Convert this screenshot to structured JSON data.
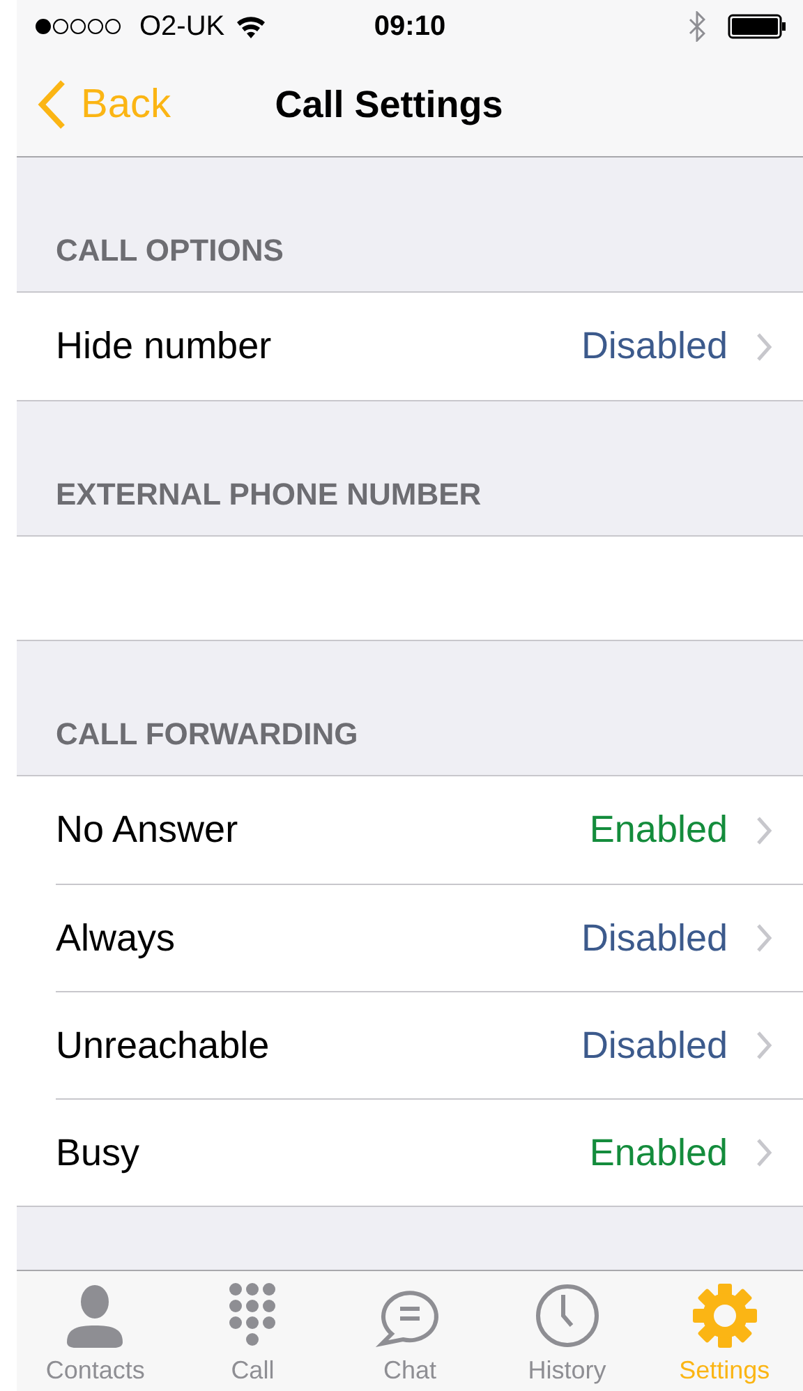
{
  "status_bar": {
    "carrier": "O2-UK",
    "time": "09:10"
  },
  "nav_bar": {
    "back": "Back",
    "title": "Call Settings"
  },
  "sections": [
    {
      "title": "CALL OPTIONS",
      "kind": "list",
      "rows": [
        {
          "label": "Hide number",
          "value": "Disabled",
          "enabled": false
        }
      ]
    },
    {
      "title": "EXTERNAL PHONE NUMBER",
      "kind": "field"
    },
    {
      "title": "CALL FORWARDING",
      "kind": "list",
      "rows": [
        {
          "label": "No Answer",
          "value": "Enabled",
          "enabled": true
        },
        {
          "label": "Always",
          "value": "Disabled",
          "enabled": false
        },
        {
          "label": "Unreachable",
          "value": "Disabled",
          "enabled": false
        },
        {
          "label": "Busy",
          "value": "Enabled",
          "enabled": true
        }
      ]
    }
  ],
  "tab_bar": [
    {
      "label": "Contacts",
      "kind": "person",
      "selected": false
    },
    {
      "label": "Call",
      "kind": "keypad",
      "selected": false
    },
    {
      "label": "Chat",
      "kind": "chat",
      "selected": false
    },
    {
      "label": "History",
      "kind": "clock",
      "selected": false
    },
    {
      "label": "Settings",
      "kind": "gear",
      "selected": true
    }
  ]
}
